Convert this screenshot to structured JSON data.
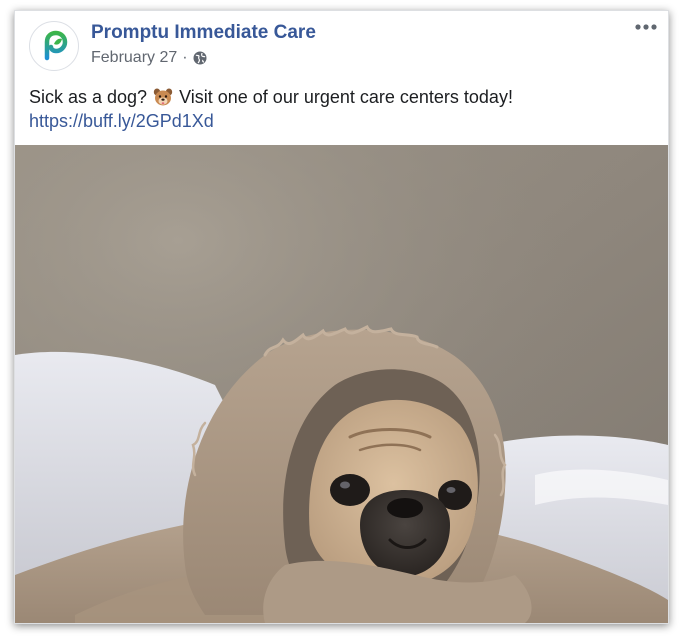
{
  "post": {
    "page_name": "Promptu Immediate Care",
    "date": "February 27",
    "separator": "·",
    "privacy_icon": "globe-icon",
    "more_icon": "more-options-icon",
    "text_before": "Sick as a dog?",
    "emoji": "dog-face-emoji",
    "text_after": "Visit one of our urgent care centers today!",
    "link": "https://buff.ly/2GPd1Xd",
    "image": "pug-in-blanket-photo"
  },
  "colors": {
    "link_blue": "#385898",
    "text": "#1c1e21",
    "meta_gray": "#616770",
    "logo_green": "#35b34a",
    "logo_blue": "#1d8fd3"
  }
}
